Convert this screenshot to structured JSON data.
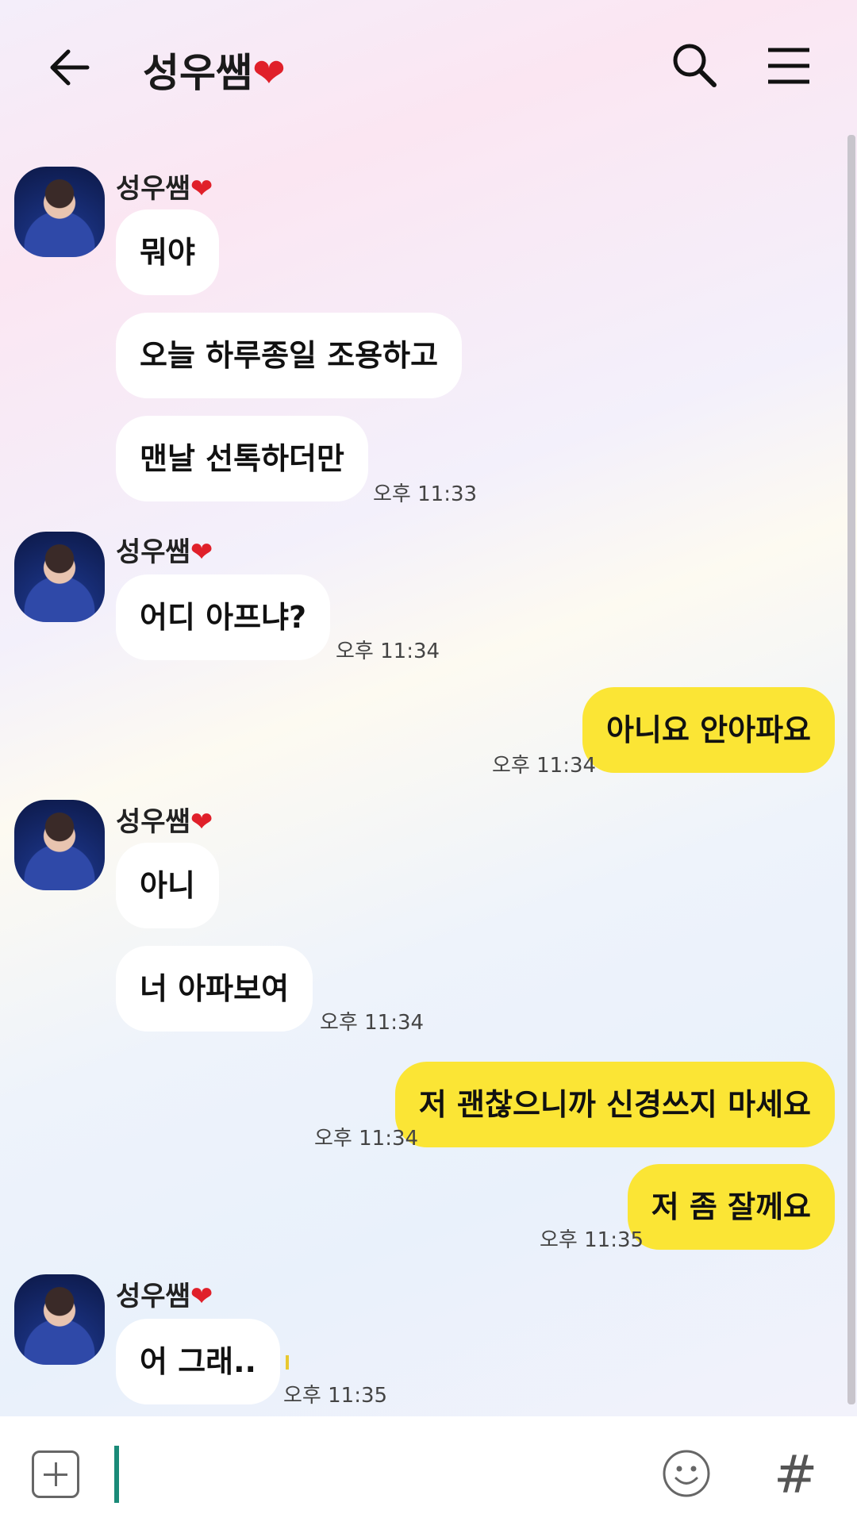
{
  "header": {
    "title": "성우쌤",
    "title_emoji": "❤"
  },
  "contact": {
    "name": "성우쌤",
    "name_emoji": "❤"
  },
  "messages": [
    {
      "from": "other",
      "text": "뭐야"
    },
    {
      "from": "other",
      "text": "오늘 하루종일 조용하고"
    },
    {
      "from": "other",
      "text": "맨날 선톡하더만",
      "time": "오후 11:33"
    },
    {
      "from": "other",
      "text": "어디 아프냐?",
      "time": "오후 11:34"
    },
    {
      "from": "me",
      "text": "아니요 안아파요",
      "time": "오후 11:34"
    },
    {
      "from": "other",
      "text": "아니"
    },
    {
      "from": "other",
      "text": "너 아파보여",
      "time": "오후 11:34"
    },
    {
      "from": "me",
      "text": "저 괜찮으니까 신경쓰지 마세요",
      "time": "오후 11:34"
    },
    {
      "from": "me",
      "text": "저 좀 잘께요",
      "time": "오후 11:35"
    },
    {
      "from": "other",
      "text": "어 그래..",
      "time": "오후 11:35"
    }
  ],
  "input": {
    "value": "",
    "hash_label": "#"
  },
  "colors": {
    "my_bubble": "#fbe535",
    "other_bubble": "#ffffff",
    "cursor": "#1a8a78",
    "heart": "#e0202a"
  }
}
